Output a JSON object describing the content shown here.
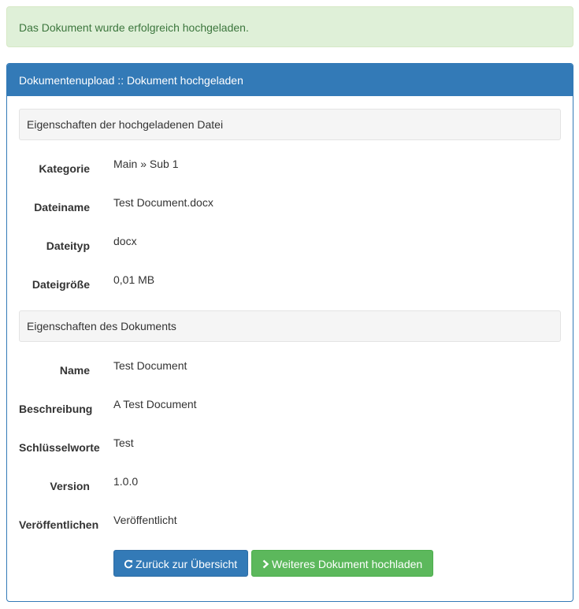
{
  "alert": {
    "message": "Das Dokument wurde erfolgreich hochgeladen."
  },
  "panel": {
    "title": "Dokumentenupload :: Dokument hochgeladen"
  },
  "file_section": {
    "title": "Eigenschaften der hochgeladenen Datei",
    "fields": [
      {
        "label": "Kategorie",
        "value": "Main » Sub 1"
      },
      {
        "label": "Dateiname",
        "value": "Test Document.docx"
      },
      {
        "label": "Dateityp",
        "value": "docx"
      },
      {
        "label": "Dateigröße",
        "value": "0,01 MB"
      }
    ]
  },
  "doc_section": {
    "title": "Eigenschaften des Dokuments",
    "fields": [
      {
        "label": "Name",
        "value": "Test Document"
      },
      {
        "label": "Beschreibung",
        "value": "A Test Document"
      },
      {
        "label": "Schlüsselworte",
        "value": "Test"
      },
      {
        "label": "Version",
        "value": "1.0.0"
      },
      {
        "label": "Veröffentlichen",
        "value": "Veröffentlicht"
      }
    ]
  },
  "actions": {
    "back_label": "Zurück zur Übersicht",
    "back_icon": "refresh-icon",
    "upload_more_label": "Weiteres Dokument hochladen",
    "upload_more_icon": "chevron-right-icon"
  },
  "colors": {
    "primary": "#337ab7",
    "success": "#5cb85c",
    "alert_bg": "#dff0d8",
    "alert_text": "#3c763d"
  }
}
